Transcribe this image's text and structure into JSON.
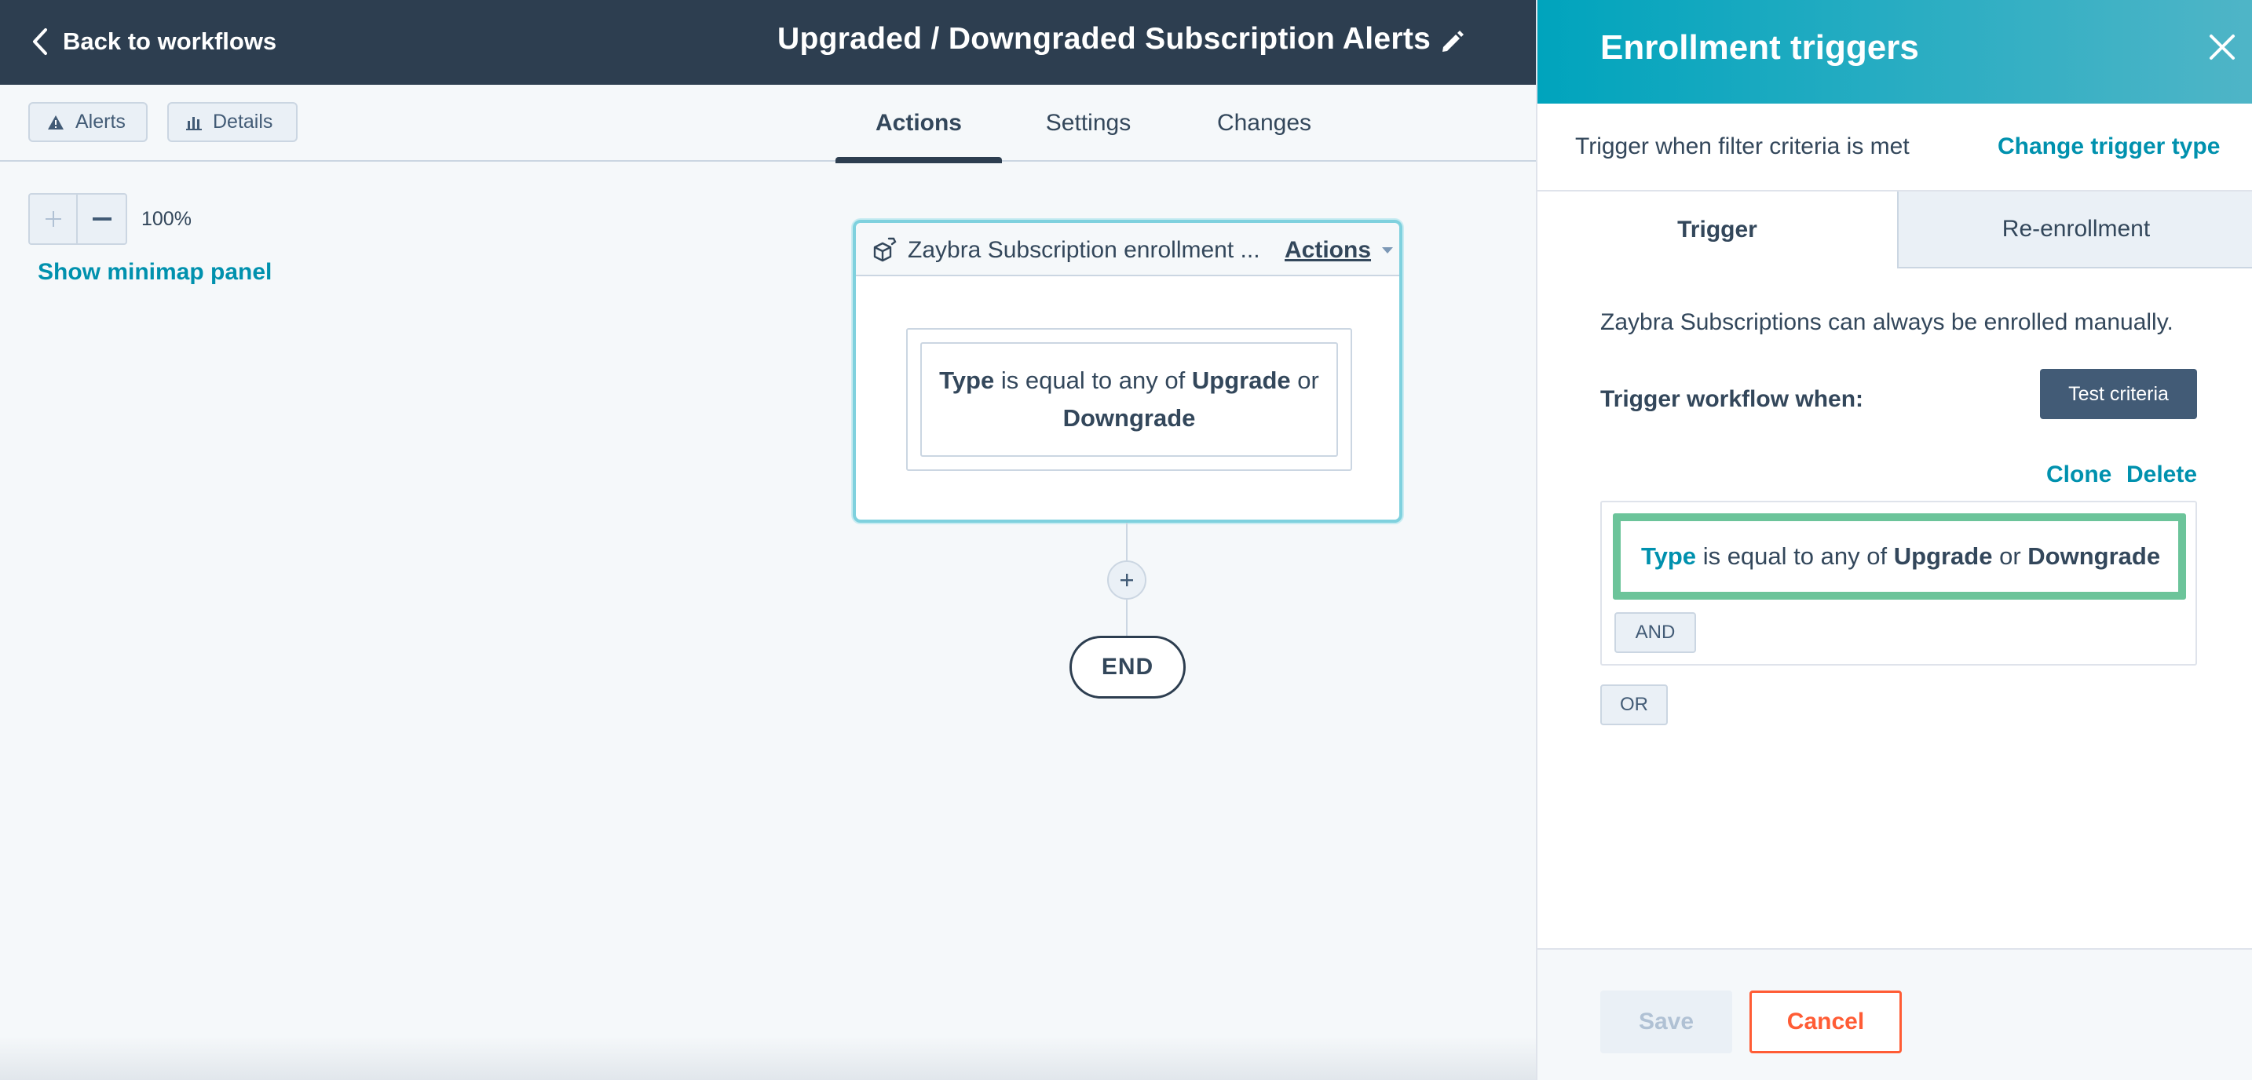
{
  "header": {
    "back_label": "Back to workflows",
    "title": "Upgraded / Downgraded Subscription Alerts"
  },
  "subbar": {
    "alerts_label": "Alerts",
    "details_label": "Details",
    "tabs": [
      {
        "label": "Actions",
        "active": true
      },
      {
        "label": "Settings",
        "active": false
      },
      {
        "label": "Changes",
        "active": false
      }
    ]
  },
  "canvas": {
    "zoom_level": "100%",
    "minimap_label": "Show minimap panel",
    "trigger_card": {
      "title": "Zaybra Subscription enrollment ...",
      "actions_label": "Actions",
      "filter": {
        "property": "Type",
        "operator": "is equal to any of",
        "value_1": "Upgrade",
        "joiner": "or",
        "value_2": "Downgrade"
      }
    },
    "end_label": "END"
  },
  "panel": {
    "title": "Enrollment triggers",
    "trigger_description": "Trigger when filter criteria is met",
    "change_trigger_label": "Change trigger type",
    "tabs": [
      {
        "label": "Trigger",
        "active": true
      },
      {
        "label": "Re-enrollment",
        "active": false
      }
    ],
    "manual_note": "Zaybra Subscriptions can always be enrolled manually.",
    "trigger_when_label": "Trigger workflow when:",
    "test_criteria_label": "Test criteria",
    "clone_label": "Clone",
    "delete_label": "Delete",
    "filter": {
      "property": "Type",
      "operator": "is equal to any of",
      "value_1": "Upgrade",
      "joiner": "or",
      "value_2": "Downgrade"
    },
    "and_label": "AND",
    "or_label": "OR",
    "save_label": "Save",
    "cancel_label": "Cancel"
  },
  "colors": {
    "header_bg": "#2d3e50",
    "panel_header_start": "#00a4bd",
    "link": "#0091ae",
    "filter_highlight": "#6cc49a",
    "cancel": "#ff5c35"
  },
  "icons": {
    "back": "chevron-left-icon",
    "edit": "pencil-icon",
    "alerts": "warning-icon",
    "details": "bar-chart-icon",
    "zoom_in": "plus-icon",
    "zoom_out": "minus-icon",
    "card": "object-cube-icon",
    "add_step": "plus-icon",
    "close": "close-icon"
  }
}
